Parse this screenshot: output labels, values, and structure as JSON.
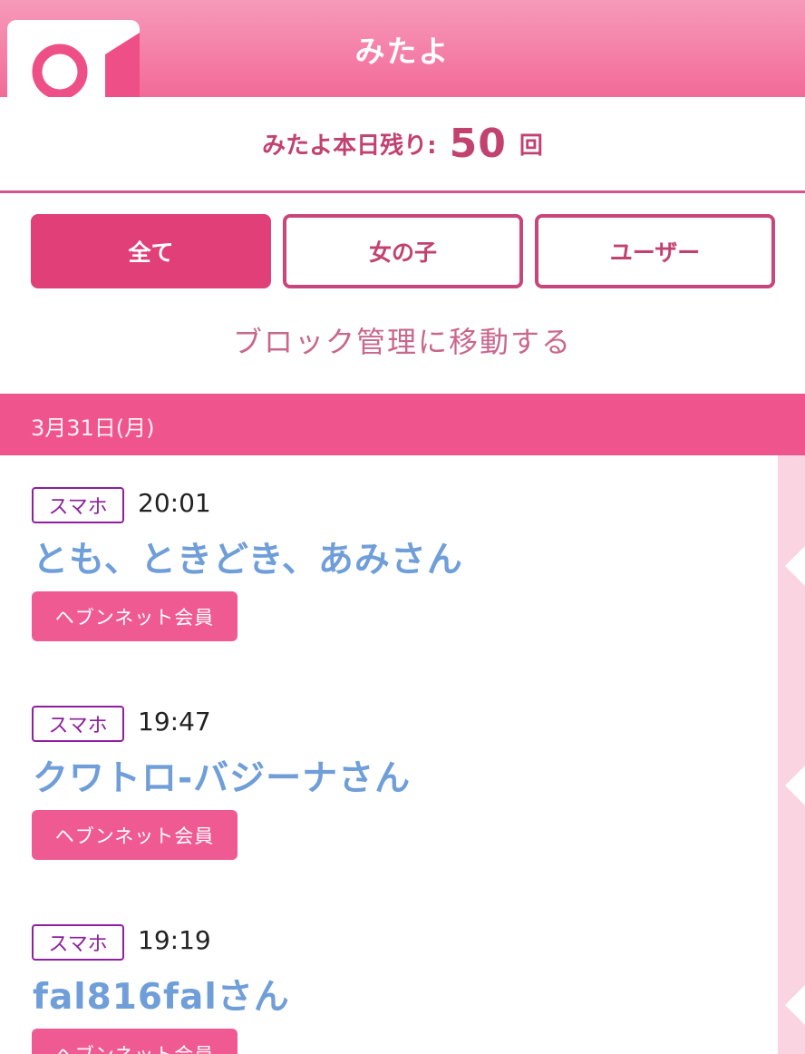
{
  "header": {
    "title": "みたよ",
    "badge_icon": "camera-icon"
  },
  "remaining": {
    "label": "みたよ本日残り:",
    "count": "50",
    "unit": "回"
  },
  "tabs": [
    {
      "label": "全て",
      "active": true
    },
    {
      "label": "女の子",
      "active": false
    },
    {
      "label": "ユーザー",
      "active": false
    }
  ],
  "block_link": "ブロック管理に移動する",
  "date_header": "3月31日(月)",
  "visitors": [
    {
      "device": "スマホ",
      "time": "20:01",
      "name": "とも、ときどき、あみさん",
      "badge": "ヘブンネット会員"
    },
    {
      "device": "スマホ",
      "time": "19:47",
      "name": "クワトロ-バジーナさん",
      "badge": "ヘブンネット会員"
    },
    {
      "device": "スマホ",
      "time": "19:19",
      "name": "fal816falさん",
      "badge": "ヘブンネット会員"
    }
  ],
  "colors": {
    "brand_pink": "#f26a98",
    "tab_active": "#e03f77",
    "name_blue": "#6f9ed8",
    "device_purple": "#8e1f9e"
  }
}
